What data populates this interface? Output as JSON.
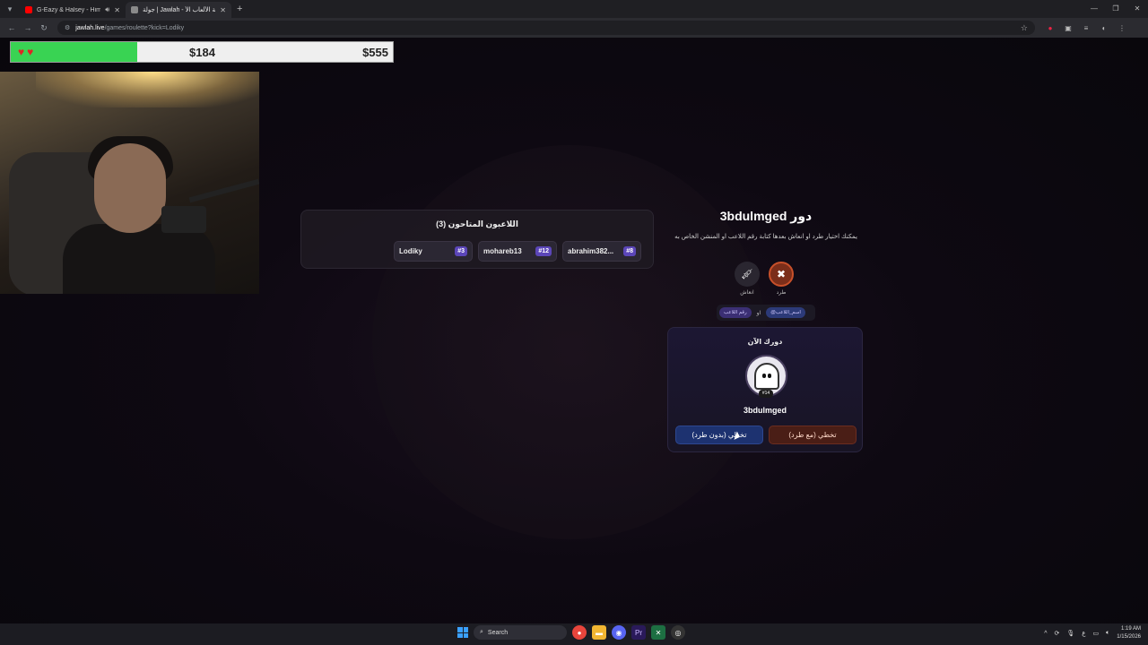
{
  "browser": {
    "tabs": [
      {
        "title": "G-Eazy & Halsey - Him & I",
        "favicon_color": "#ff0000",
        "has_audio": true
      },
      {
        "title": "جولة | Jawlah - منصة الألعاب الأ...",
        "favicon_color": "#8a8a8a",
        "has_audio": false
      }
    ],
    "new_tab_icon": "plus-icon",
    "url_host": "jawlah.live",
    "url_path": "/games/roulette?kick=Lodiky"
  },
  "hud": {
    "hearts": [
      "♥",
      "♥"
    ],
    "current_value": "$184",
    "target_value": "$555",
    "progress_fraction": 0.33,
    "fill_color": "#39d353"
  },
  "players": {
    "title": "اللاعبون المتاحون (3)",
    "items": [
      {
        "name": "Lodiky",
        "num": "#3"
      },
      {
        "name": "mohareb13",
        "num": "#12"
      },
      {
        "name": "abrahim382...",
        "num": "#8"
      }
    ]
  },
  "turn": {
    "title": "دور 3bdulmged",
    "description": "يمكنك اختيار طرد او انعاش بعدها كتابة رقم اللاعب او المنشن الخاص به",
    "tools": [
      {
        "label": "انعاش",
        "icon": "syringe-icon"
      },
      {
        "label": "طرد",
        "icon": "kick-icon"
      }
    ],
    "mention_pill": "@اسم_اللاعب",
    "or_text": "او",
    "number_pill": "رقم اللاعب"
  },
  "now_card": {
    "label": "دورك الآن",
    "badge": "#14",
    "username": "3bdulmged",
    "pass_label": "تخطي (بدون طرد)",
    "pass_kick_label": "تخطي (مع طرد)"
  },
  "taskbar": {
    "search_placeholder": "Search",
    "language": "ع",
    "time": "1:19 AM",
    "date": "1/15/2026"
  }
}
